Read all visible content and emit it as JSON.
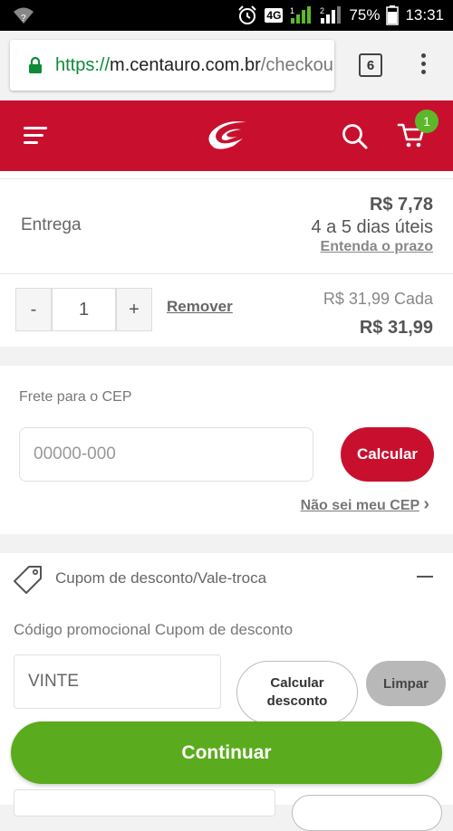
{
  "statusbar": {
    "signal_question": "?",
    "network_badge": "4G",
    "sim_label": "1",
    "sim2_label": "2",
    "battery_percent": "75%",
    "time": "13:31"
  },
  "browser": {
    "url_scheme": "https://",
    "url_host": "m.centauro.com.br",
    "url_path": "/checkou",
    "tab_count": "6"
  },
  "header": {
    "cart_count": "1",
    "brand_color": "#c8102e"
  },
  "delivery": {
    "label": "Entrega",
    "price": "R$ 7,78",
    "days": "4 a 5 dias úteis",
    "link": "Entenda o prazo"
  },
  "item": {
    "minus_label": "-",
    "quantity": "1",
    "plus_label": "+",
    "remove_label": "Remover",
    "unit_price": "R$ 31,99 Cada",
    "total_price": "R$ 31,99"
  },
  "cep": {
    "label": "Frete para o CEP",
    "placeholder": "00000-000",
    "calc_label": "Calcular",
    "help_link": "Não sei meu CEP",
    "help_arrow": "›"
  },
  "coupon": {
    "title": "Cupom de desconto/Vale-troca",
    "promo_label": "Código promocional Cupom de desconto",
    "code_value": "VINTE",
    "calc_line1": "Calcular",
    "calc_line2": "desconto",
    "clear_label": "Limpar"
  },
  "footer": {
    "continue_label": "Continuar",
    "continue_color": "#5bab1e"
  }
}
